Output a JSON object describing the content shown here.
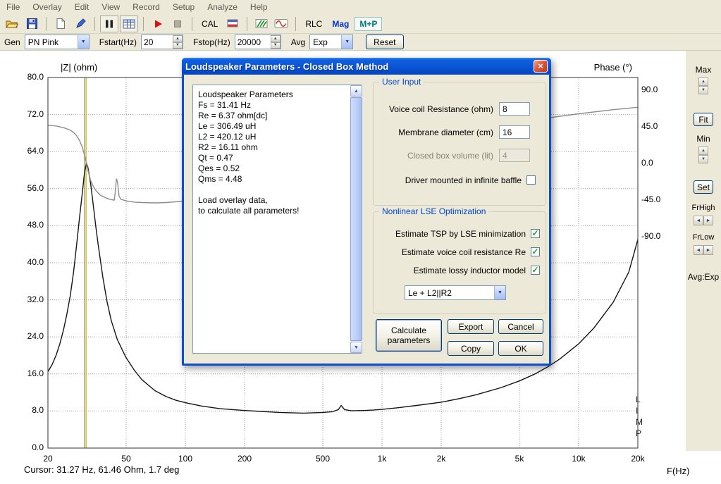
{
  "menu": {
    "items": [
      "File",
      "Overlay",
      "Edit",
      "View",
      "Record",
      "Setup",
      "Analyze",
      "Help"
    ]
  },
  "toolbar": {
    "cal": "CAL",
    "rlc": "RLC",
    "mag": "Mag",
    "mp": "M+P"
  },
  "genbar": {
    "gen_label": "Gen",
    "gen_value": "PN Pink",
    "fstart_label": "Fstart(Hz)",
    "fstart_value": "20",
    "fstop_label": "Fstop(Hz)",
    "fstop_value": "20000",
    "avg_label": "Avg",
    "avg_value": "Exp",
    "reset": "Reset"
  },
  "sidebar": {
    "max": "Max",
    "fit": "Fit",
    "min": "Min",
    "set": "Set",
    "frhigh": "FrHigh",
    "frlow": "FrLow",
    "avg": "Avg:Exp"
  },
  "chart": {
    "left_title": "|Z| (ohm)",
    "right_title": "Phase (°)",
    "xaxis_label": "F(Hz)",
    "watermark": "LIMP"
  },
  "chart_data": {
    "type": "line",
    "x_scale": "log",
    "x_range": [
      20,
      20000
    ],
    "x_ticks": [
      [
        20,
        "20"
      ],
      [
        50,
        "50"
      ],
      [
        100,
        "100"
      ],
      [
        200,
        "200"
      ],
      [
        500,
        "500"
      ],
      [
        1000,
        "1k"
      ],
      [
        2000,
        "2k"
      ],
      [
        5000,
        "5k"
      ],
      [
        10000,
        "10k"
      ],
      [
        20000,
        "20k"
      ]
    ],
    "y_left": {
      "label": "|Z| (ohm)",
      "min": 0,
      "max": 80,
      "step": 8
    },
    "y_right": {
      "label": "Phase (°)",
      "min": -90,
      "max": 90,
      "ticks": [
        90,
        45,
        0,
        -45,
        -90
      ]
    },
    "grid": true,
    "cursors": [
      {
        "name": "marker",
        "freq": 30.7,
        "color": "#9a9150"
      },
      {
        "name": "cursor",
        "freq": 31.27,
        "color": "#ccb800"
      }
    ],
    "series": [
      {
        "name": "impedance",
        "axis": "left",
        "color": "#151515",
        "points": [
          [
            20,
            16.5
          ],
          [
            21,
            18
          ],
          [
            22,
            20
          ],
          [
            23,
            22.5
          ],
          [
            24,
            25.5
          ],
          [
            25,
            29
          ],
          [
            26,
            33
          ],
          [
            27,
            38
          ],
          [
            28,
            44
          ],
          [
            29,
            50
          ],
          [
            30,
            55.5
          ],
          [
            30.7,
            59.5
          ],
          [
            31.4,
            61.5
          ],
          [
            32,
            60.5
          ],
          [
            33,
            57
          ],
          [
            34,
            52.5
          ],
          [
            35,
            48
          ],
          [
            36,
            44
          ],
          [
            38,
            37
          ],
          [
            40,
            31.5
          ],
          [
            42,
            27.5
          ],
          [
            45,
            23.5
          ],
          [
            48,
            21
          ],
          [
            50,
            19.5
          ],
          [
            55,
            16.8
          ],
          [
            60,
            14.8
          ],
          [
            70,
            12.4
          ],
          [
            80,
            11.1
          ],
          [
            90,
            10.3
          ],
          [
            100,
            9.8
          ],
          [
            120,
            9.1
          ],
          [
            150,
            8.5
          ],
          [
            200,
            8.1
          ],
          [
            300,
            7.7
          ],
          [
            400,
            7.55
          ],
          [
            500,
            7.7
          ],
          [
            560,
            7.85
          ],
          [
            600,
            8.3
          ],
          [
            620,
            9.2
          ],
          [
            645,
            8.3
          ],
          [
            700,
            8.05
          ],
          [
            800,
            8.1
          ],
          [
            900,
            8.2
          ],
          [
            1000,
            8.35
          ],
          [
            1200,
            8.7
          ],
          [
            1500,
            9.2
          ],
          [
            2000,
            9.9
          ],
          [
            2500,
            10.7
          ],
          [
            3000,
            11.5
          ],
          [
            4000,
            13.0
          ],
          [
            5000,
            14.5
          ],
          [
            6000,
            16.0
          ],
          [
            7000,
            17.6
          ],
          [
            8000,
            19.2
          ],
          [
            10000,
            22.5
          ],
          [
            12000,
            26
          ],
          [
            15000,
            31.5
          ],
          [
            18000,
            38
          ],
          [
            20000,
            45
          ]
        ]
      },
      {
        "name": "phase",
        "axis": "right",
        "color": "#8c8c8c",
        "points": [
          [
            20,
            47
          ],
          [
            22,
            46
          ],
          [
            24,
            44
          ],
          [
            26,
            41
          ],
          [
            27,
            38
          ],
          [
            28,
            34
          ],
          [
            29,
            28
          ],
          [
            30,
            19
          ],
          [
            30.8,
            9
          ],
          [
            31.4,
            0
          ],
          [
            32,
            -9
          ],
          [
            33,
            -21
          ],
          [
            34,
            -28
          ],
          [
            35,
            -33
          ],
          [
            37,
            -39
          ],
          [
            40,
            -43
          ],
          [
            42,
            -44.5
          ],
          [
            43.5,
            -45
          ],
          [
            44,
            -35
          ],
          [
            44.6,
            -19
          ],
          [
            45.2,
            -23
          ],
          [
            46,
            -40
          ],
          [
            47,
            -44
          ],
          [
            50,
            -46
          ],
          [
            55,
            -47.5
          ],
          [
            60,
            -48
          ],
          [
            70,
            -48.5
          ],
          [
            80,
            -48
          ],
          [
            100,
            -46
          ],
          [
            130,
            -42
          ],
          [
            160,
            -38
          ],
          [
            200,
            -33
          ],
          [
            300,
            -24
          ],
          [
            400,
            -16
          ],
          [
            500,
            -10
          ],
          [
            700,
            -2
          ],
          [
            1000,
            8
          ],
          [
            1500,
            20
          ],
          [
            2000,
            28
          ],
          [
            3000,
            38
          ],
          [
            4000,
            45
          ],
          [
            5000,
            50
          ],
          [
            7000,
            56
          ],
          [
            10000,
            61
          ],
          [
            15000,
            66
          ],
          [
            20000,
            69
          ]
        ]
      }
    ]
  },
  "dialog": {
    "title": "Loudspeaker Parameters - Closed Box Method",
    "results_lines": [
      "Loudspeaker Parameters",
      "Fs = 31.41 Hz",
      "Re = 6.37 ohm[dc]",
      "Le = 306.49 uH",
      "L2 = 420.12 uH",
      "R2 = 16.11 ohm",
      "Qt = 0.47",
      "Qes = 0.52",
      "Qms = 4.48",
      "",
      "Load overlay data,",
      "to calculate all parameters!"
    ],
    "user_input": {
      "title": "User Input",
      "rows": [
        {
          "label": "Voice coil Resistance (ohm)",
          "value": "8"
        },
        {
          "label": "Membrane diameter (cm)",
          "value": "16"
        },
        {
          "label": "Closed box volume (lit)",
          "value": "4"
        }
      ],
      "baffle_label": "Driver mounted in infinite baffle"
    },
    "lse": {
      "title": "Nonlinear LSE Optimization",
      "checks": [
        "Estimate TSP by LSE minimization",
        "Estimate voice coil resistance Re",
        "Estimate lossy inductor model"
      ],
      "model_value": "Le + L2||R2"
    },
    "buttons": {
      "calculate": "Calculate parameters",
      "export": "Export",
      "cancel": "Cancel",
      "copy": "Copy",
      "ok": "OK"
    }
  },
  "status": {
    "cursor": "Cursor: 31.27 Hz, 61.46 Ohm, 1.7 deg"
  }
}
